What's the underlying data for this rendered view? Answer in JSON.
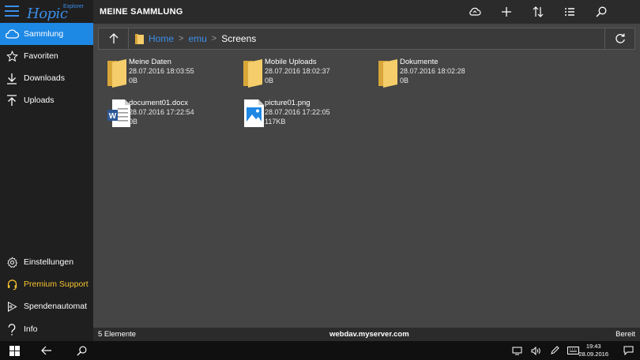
{
  "app": {
    "logo_text": "Hopic",
    "logo_sub": "Explorer",
    "accent": "#1e88e5",
    "premium_color": "#f6c431"
  },
  "sidebar": {
    "top_items": [
      {
        "label": "Sammlung",
        "icon": "cloud-icon",
        "active": true
      },
      {
        "label": "Favoriten",
        "icon": "star-icon"
      },
      {
        "label": "Downloads",
        "icon": "download-icon"
      },
      {
        "label": "Uploads",
        "icon": "upload-icon"
      }
    ],
    "bottom_items": [
      {
        "label": "Einstellungen",
        "icon": "gear-icon"
      },
      {
        "label": "Premium Support",
        "icon": "headset-icon"
      },
      {
        "label": "Spendenautomat",
        "icon": "donate-icon"
      },
      {
        "label": "Info",
        "icon": "question-icon"
      }
    ]
  },
  "header": {
    "title": "MEINE SAMMLUNG",
    "toolbar": [
      "cloud-sync-icon",
      "add-icon",
      "sort-icon",
      "list-view-icon",
      "search-icon"
    ]
  },
  "path": {
    "crumbs": [
      "Home",
      "emu",
      "Screens"
    ]
  },
  "files": [
    {
      "name": "Meine Daten",
      "date": "28.07.2016 18:03:55",
      "size": "0B",
      "type": "folder"
    },
    {
      "name": "Mobile Uploads",
      "date": "28.07.2016 18:02:37",
      "size": "0B",
      "type": "folder"
    },
    {
      "name": "Dokumente",
      "date": "28.07.2016 18:02:28",
      "size": "0B",
      "type": "folder"
    },
    {
      "name": "document01.docx",
      "date": "28.07.2016 17:22:54",
      "size": "0B",
      "type": "word"
    },
    {
      "name": "picture01.png",
      "date": "28.07.2016 17:22:05",
      "size": "117KB",
      "type": "image"
    }
  ],
  "status": {
    "count": "5 Elemente",
    "server": "webdav.myserver.com",
    "state": "Bereit"
  },
  "taskbar": {
    "time": "19:43",
    "date": "28.09.2016"
  }
}
